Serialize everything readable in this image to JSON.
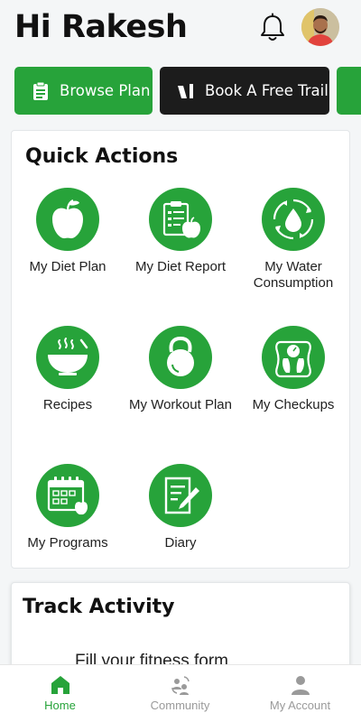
{
  "header": {
    "greeting": "Hi Rakesh"
  },
  "promos": [
    {
      "label": "Browse Plan"
    },
    {
      "label": "Book A Free Trail"
    }
  ],
  "quick_actions": {
    "title": "Quick Actions",
    "items": [
      {
        "label": "My Diet Plan",
        "icon": "apple-icon"
      },
      {
        "label": "My Diet Report",
        "icon": "clipboard-apple-icon"
      },
      {
        "label": "My Water Consumption",
        "icon": "water-drop-icon"
      },
      {
        "label": "Recipes",
        "icon": "bowl-icon"
      },
      {
        "label": "My Workout Plan",
        "icon": "kettlebell-icon"
      },
      {
        "label": "My Checkups",
        "icon": "scale-icon"
      },
      {
        "label": "My Programs",
        "icon": "calendar-icon"
      },
      {
        "label": "Diary",
        "icon": "notebook-icon"
      }
    ]
  },
  "track_activity": {
    "title": "Track Activity",
    "text": "Fill your fitness form"
  },
  "nav": {
    "home": "Home",
    "community": "Community",
    "account": "My Account"
  },
  "colors": {
    "accent": "#27a33a",
    "dark_button": "#1c1c1c"
  }
}
